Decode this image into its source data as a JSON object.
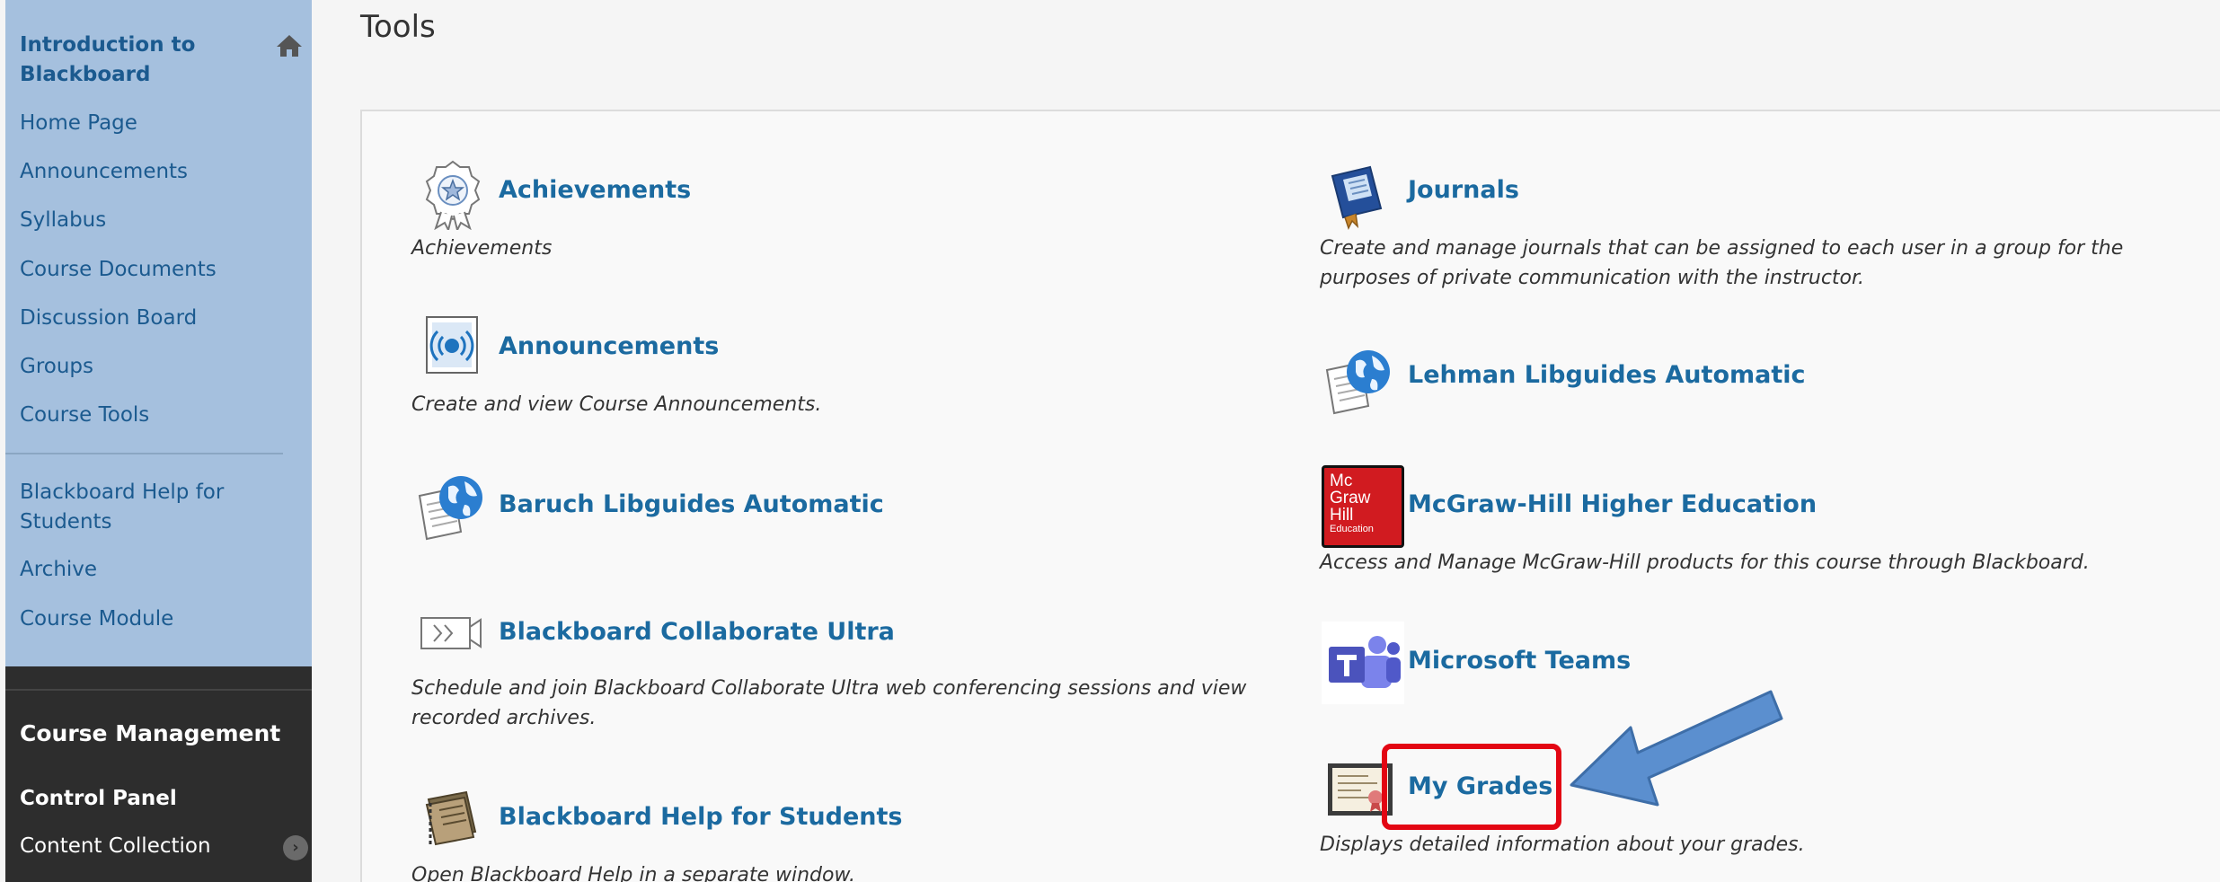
{
  "sidebar": {
    "course_title": "Introduction to Blackboard",
    "menu": [
      {
        "label": "Home Page"
      },
      {
        "label": "Announcements"
      },
      {
        "label": "Syllabus"
      },
      {
        "label": "Course Documents"
      },
      {
        "label": "Discussion Board"
      },
      {
        "label": "Groups"
      },
      {
        "label": "Course Tools"
      }
    ],
    "menu2": [
      {
        "label": "Blackboard Help for Students"
      },
      {
        "label": "Archive"
      },
      {
        "label": "Course Module"
      }
    ],
    "management": {
      "heading": "Course Management",
      "control_panel": "Control Panel",
      "content_collection": "Content Collection"
    }
  },
  "page": {
    "title": "Tools"
  },
  "tools_left": [
    {
      "name": "Achievements",
      "icon": "achievement-ribbon-icon",
      "description": "Achievements"
    },
    {
      "name": "Announcements",
      "icon": "announcements-broadcast-icon",
      "description": "Create and view Course Announcements."
    },
    {
      "name": "Baruch Libguides Automatic",
      "icon": "globe-document-icon",
      "description": ""
    },
    {
      "name": "Blackboard Collaborate Ultra",
      "icon": "collaborate-ultra-icon",
      "description": "Schedule and join Blackboard Collaborate Ultra web conferencing sessions and view recorded archives."
    },
    {
      "name": "Blackboard Help for Students",
      "icon": "help-book-icon",
      "description": "Open Blackboard Help in a separate window."
    }
  ],
  "tools_right": [
    {
      "name": "Journals",
      "icon": "journal-book-icon",
      "description": "Create and manage journals that can be assigned to each user in a group for the purposes of private communication with the instructor."
    },
    {
      "name": "Lehman Libguides Automatic",
      "icon": "globe-document-icon",
      "description": ""
    },
    {
      "name": "McGraw-Hill Higher Education",
      "icon": "mcgraw-hill-logo-icon",
      "logo_text": [
        "Mc",
        "Graw",
        "Hill",
        "Education"
      ],
      "description": "Access and Manage McGraw-Hill products for this course through Blackboard."
    },
    {
      "name": "Microsoft Teams",
      "icon": "microsoft-teams-icon",
      "description": ""
    },
    {
      "name": "My Grades",
      "icon": "certificate-icon",
      "description": "Displays detailed information about your grades."
    }
  ],
  "annotation": {
    "highlight_color": "#e30613",
    "arrow_color": "#5b8fcf"
  },
  "colors": {
    "sidebar_bg": "#a5c0de",
    "link": "#1b6aa0",
    "mgmt_bg": "#2d2d2d"
  }
}
